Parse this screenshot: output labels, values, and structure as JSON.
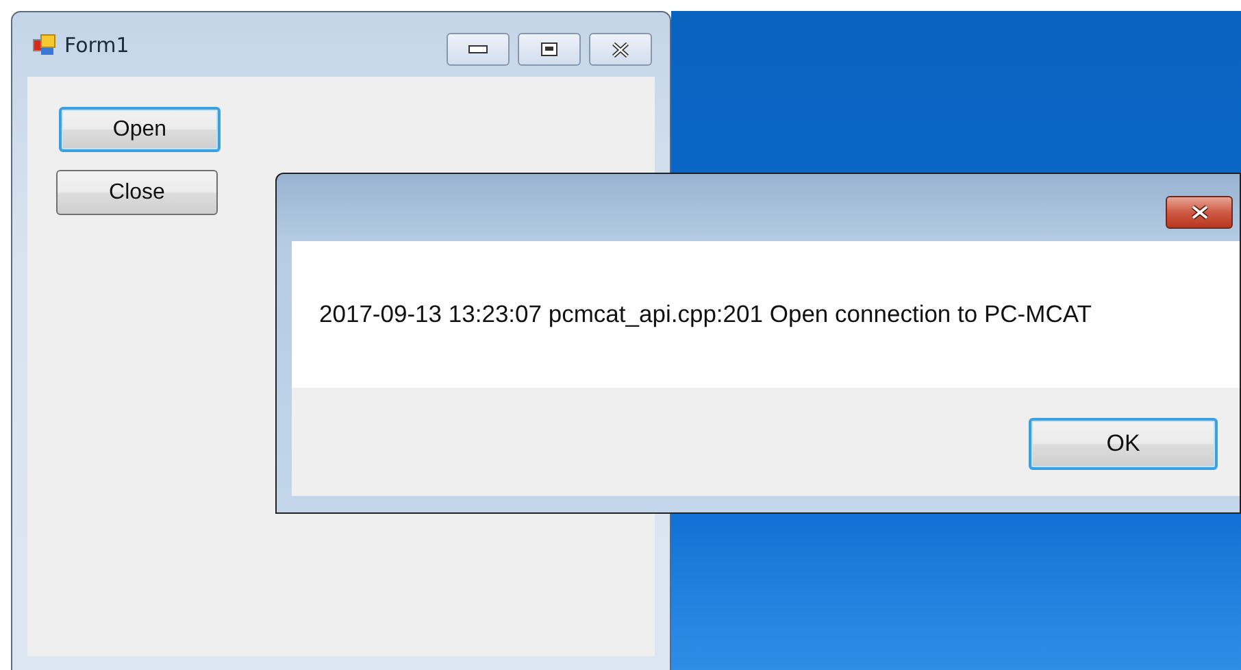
{
  "main_window": {
    "title": "Form1",
    "buttons": [
      {
        "label": "Open",
        "focused": true
      },
      {
        "label": "Close",
        "focused": false
      }
    ]
  },
  "message_box": {
    "message": "2017-09-13 13:23:07 pcmcat_api.cpp:201 Open connection to PC-MCAT",
    "buttons": [
      {
        "label": "OK",
        "focused": true
      }
    ]
  }
}
